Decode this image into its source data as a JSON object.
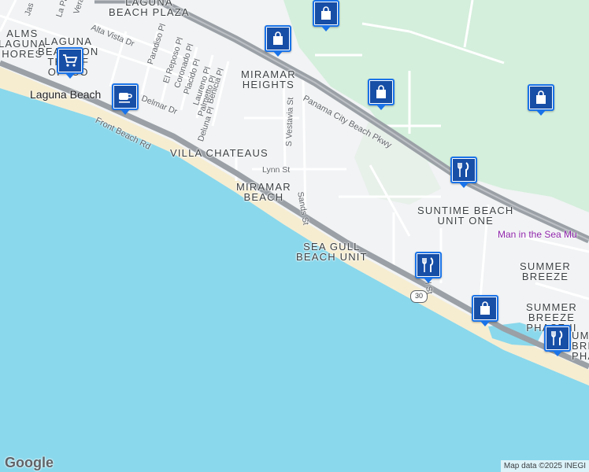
{
  "map": {
    "colors": {
      "water": "#8ad8ec",
      "sand": "#f6edd1",
      "land": "#f1f3f4",
      "park": "#d4efdc",
      "highway": "#9aa0a6",
      "road": "#ffffff",
      "marker": "#174ea6",
      "museum_text": "#8e24aa"
    },
    "areas": [
      {
        "name": "laguna-beach-plaza",
        "lines": [
          "LAGUNA",
          "BEACH PLAZA"
        ]
      },
      {
        "name": "palms-laguna-shores",
        "lines": [
          "ALMS",
          "LAGUNA",
          "HORES"
        ]
      },
      {
        "name": "laguna-beach-gulf",
        "lines": [
          "LAGUNA",
          "BEACH ON",
          "TH   ULF",
          "OF    ICO"
        ]
      },
      {
        "name": "miramar-heights",
        "lines": [
          "MIRAMAR",
          "HEIGHTS"
        ]
      },
      {
        "name": "villa-chateaus",
        "lines": [
          "VILLA CHATEAUS"
        ]
      },
      {
        "name": "miramar-beach",
        "lines": [
          "MIRAMAR",
          "BEACH"
        ]
      },
      {
        "name": "sea-gull-beach-unit",
        "lines": [
          "SEA GULL",
          "BEACH UNIT"
        ]
      },
      {
        "name": "suntime-beach-unit-one",
        "lines": [
          "SUNTIME BEACH",
          "UNIT ONE"
        ]
      },
      {
        "name": "summer-breeze",
        "lines": [
          "SUMMER",
          "BREEZE"
        ]
      },
      {
        "name": "summer-breeze-phase-ii",
        "lines": [
          "SUMMER",
          "BREEZE",
          "PHASE II"
        ]
      },
      {
        "name": "summer-breeze-phase-partial",
        "lines": [
          "UM",
          "BRE",
          "PHA"
        ]
      }
    ],
    "city": "Laguna Beach",
    "streets": [
      {
        "name": "front-beach-rd",
        "text": "Front Beach Rd"
      },
      {
        "name": "panama-city-beach-pkwy",
        "text": "Panama City Beach Pkwy"
      },
      {
        "name": "alta-vista-dr",
        "text": "Alta Vista Dr"
      },
      {
        "name": "delmar-dr",
        "text": "Delmar Dr"
      },
      {
        "name": "paradiso-pl",
        "text": "Paradiso Pl"
      },
      {
        "name": "el-reposo-pl",
        "text": "El Reposo Pl"
      },
      {
        "name": "coronado-pl",
        "text": "Coronado Pl"
      },
      {
        "name": "placido-pl",
        "text": "Placido Pl"
      },
      {
        "name": "laureno-pl",
        "text": "Laureno Pl"
      },
      {
        "name": "palmetto-pl",
        "text": "Palmetto Pl"
      },
      {
        "name": "benicia-pl",
        "text": "Benicia Pl"
      },
      {
        "name": "deluna-pl",
        "text": "Deluna Pl"
      },
      {
        "name": "s-vestavia-st",
        "text": "S Vestavia St"
      },
      {
        "name": "lynn-st",
        "text": "Lynn St"
      },
      {
        "name": "sands-st",
        "text": "Sands St"
      },
      {
        "name": "jas-partial",
        "text": "Jas"
      },
      {
        "name": "la-palom-partial",
        "text": "La Palom"
      },
      {
        "name": "vera-partial",
        "text": "Vera"
      },
      {
        "name": "partial-st",
        "text": "l St"
      }
    ],
    "route_shield": "30",
    "museum": "Man in the Sea Mu",
    "pois": [
      {
        "name": "shopping-bag-1",
        "icon": "shopping-bag-icon"
      },
      {
        "name": "shopping-bag-2",
        "icon": "shopping-bag-icon"
      },
      {
        "name": "shopping-cart-1",
        "icon": "shopping-cart-icon"
      },
      {
        "name": "coffee-1",
        "icon": "coffee-cup-icon"
      },
      {
        "name": "shopping-bag-3",
        "icon": "shopping-bag-icon"
      },
      {
        "name": "shopping-bag-4",
        "icon": "shopping-bag-icon"
      },
      {
        "name": "restaurant-1",
        "icon": "fork-knife-icon"
      },
      {
        "name": "restaurant-2",
        "icon": "fork-knife-icon"
      },
      {
        "name": "shopping-bag-5",
        "icon": "shopping-bag-icon"
      },
      {
        "name": "restaurant-3",
        "icon": "fork-knife-icon"
      }
    ],
    "logo": "Google",
    "attribution": "Map data ©2025 INEGI"
  }
}
